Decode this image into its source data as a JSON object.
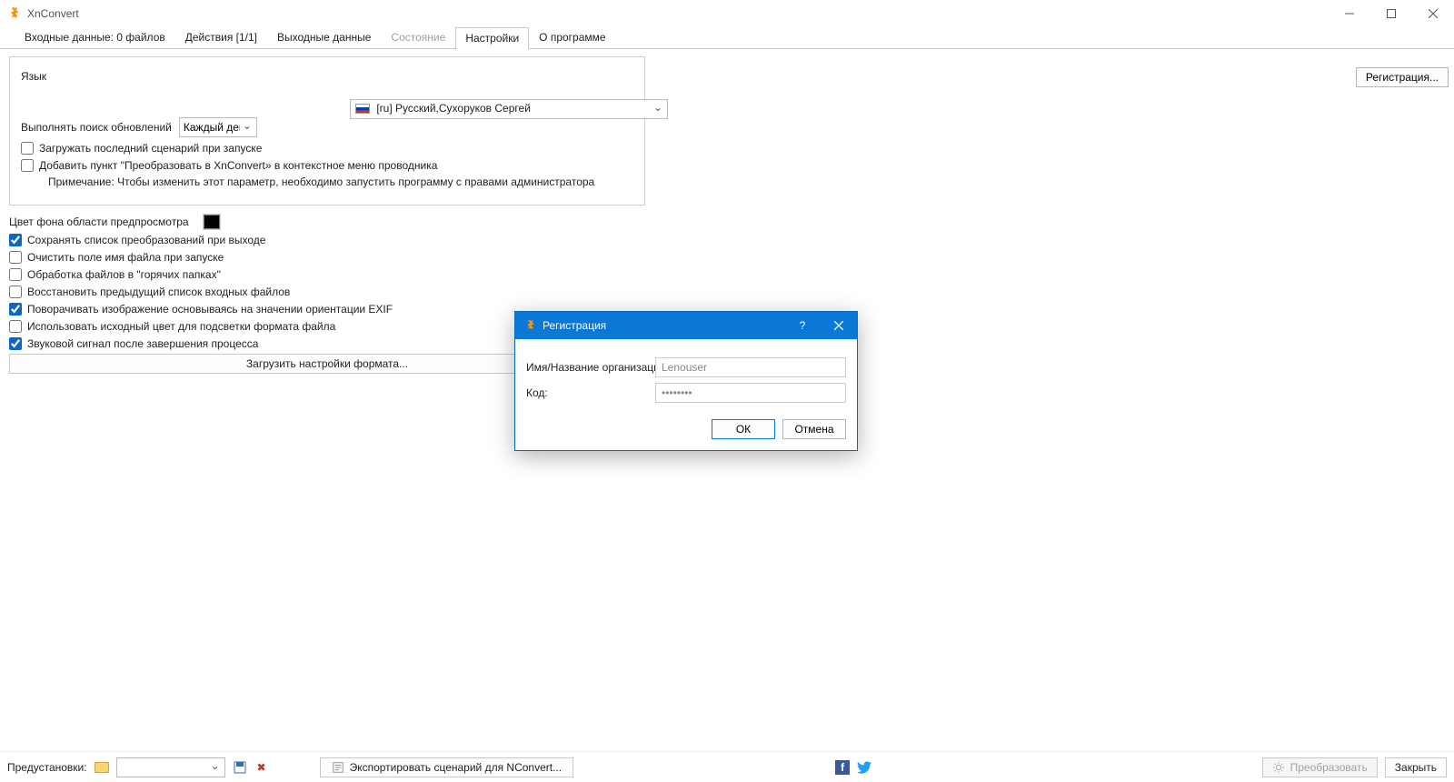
{
  "window": {
    "title": "XnConvert"
  },
  "tabs": [
    {
      "label": "Входные данные: 0 файлов"
    },
    {
      "label": "Действия [1/1]"
    },
    {
      "label": "Выходные данные"
    },
    {
      "label": "Состояние"
    },
    {
      "label": "Настройки"
    },
    {
      "label": "О программе"
    }
  ],
  "settings": {
    "language_label": "Язык",
    "language_value": "[ru] Русский,Сухоруков Сергей",
    "update_label": "Выполнять поиск обновлений",
    "update_value": "Каждый день",
    "load_last_script": "Загружать последний сценарий при запуске",
    "add_context_menu": "Добавить пункт \"Преобразовать в XnConvert» в контекстное меню проводника",
    "note": "Примечание: Чтобы изменить этот параметр, необходимо запустить программу с правами администратора",
    "preview_bg_label": "Цвет фона области предпросмотра",
    "preview_bg_color": "#000000",
    "save_actions_exit": "Сохранять список преобразований при выходе",
    "clear_filename": "Очистить поле имя файла при запуске",
    "hot_folders": "Обработка файлов в \"горячих папках\"",
    "restore_inputs": "Восстановить предыдущий список входных файлов",
    "rotate_exif": "Поворачивать изображение основываясь на значении ориентации EXIF",
    "use_src_color": "Использовать исходный цвет для подсветки формата файла",
    "beep": "Звуковой сигнал после завершения процесса",
    "load_format_btn": "Загрузить настройки формата..."
  },
  "side": {
    "register_btn": "Регистрация..."
  },
  "dialog": {
    "title": "Регистрация",
    "name_label": "Имя/Название организации:",
    "name_placeholder": "Lenouser",
    "code_label": "Код:",
    "code_value": "••••••••",
    "ok": "ОК",
    "cancel": "Отмена"
  },
  "footer": {
    "presets_label": "Предустановки:",
    "export_btn": "Экспортировать сценарий для NConvert...",
    "convert_btn": "Преобразовать",
    "close_btn": "Закрыть"
  }
}
